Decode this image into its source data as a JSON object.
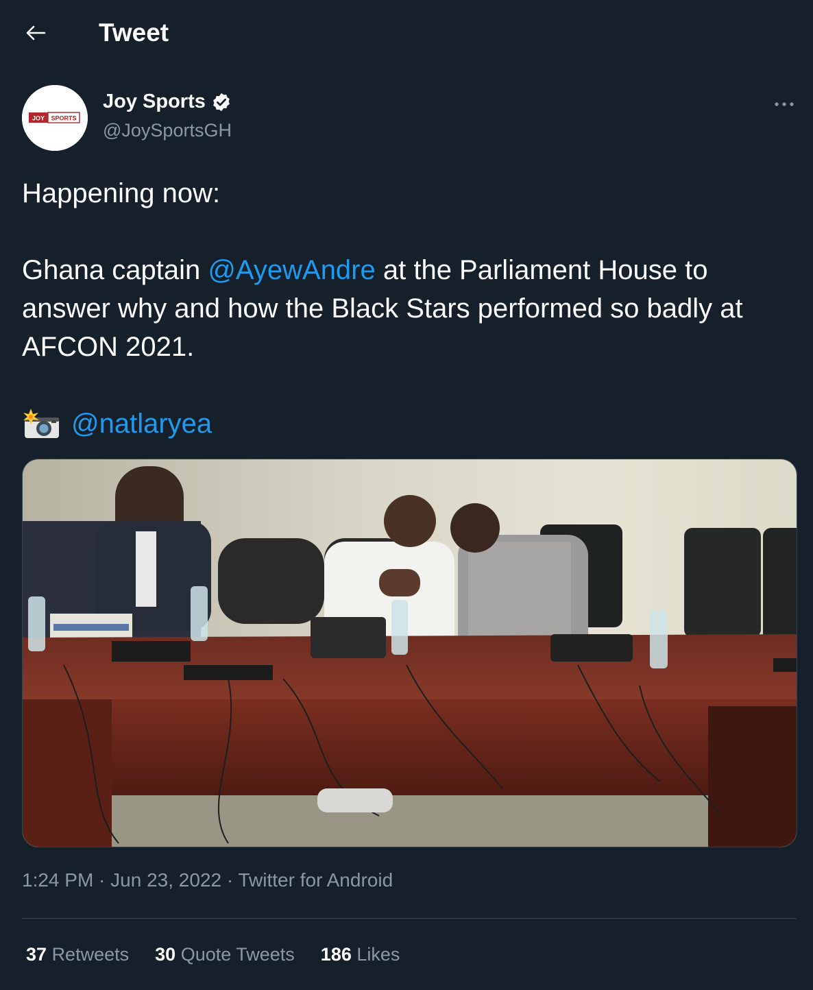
{
  "header": {
    "title": "Tweet",
    "back_icon": "arrow-left-icon"
  },
  "author": {
    "name": "Joy Sports",
    "handle": "@JoySportsGH",
    "verified": true,
    "avatar_logo": {
      "left": "JOY",
      "right": "SPORTS"
    }
  },
  "tweet": {
    "line1": "Happening now:",
    "p2_before": "Ghana captain ",
    "p2_mention": "@AyewAndre",
    "p2_after": " at the Parliament House to answer why and how the Black Stars performed so badly at AFCON 2021.",
    "camera_emoji": "📸",
    "photo_credit": "@natlaryea"
  },
  "meta": {
    "time": "1:24 PM",
    "sep1": " · ",
    "date": "Jun 23, 2022",
    "sep2": " · ",
    "source": "Twitter for Android"
  },
  "stats": [
    {
      "count": "37",
      "label": "Retweets"
    },
    {
      "count": "30",
      "label": "Quote Tweets"
    },
    {
      "count": "186",
      "label": "Likes"
    }
  ],
  "colors": {
    "background": "#15202b",
    "link": "#1d9bf0",
    "secondary": "#8b98a5",
    "border": "#38444d",
    "verified": "#ffffff"
  }
}
